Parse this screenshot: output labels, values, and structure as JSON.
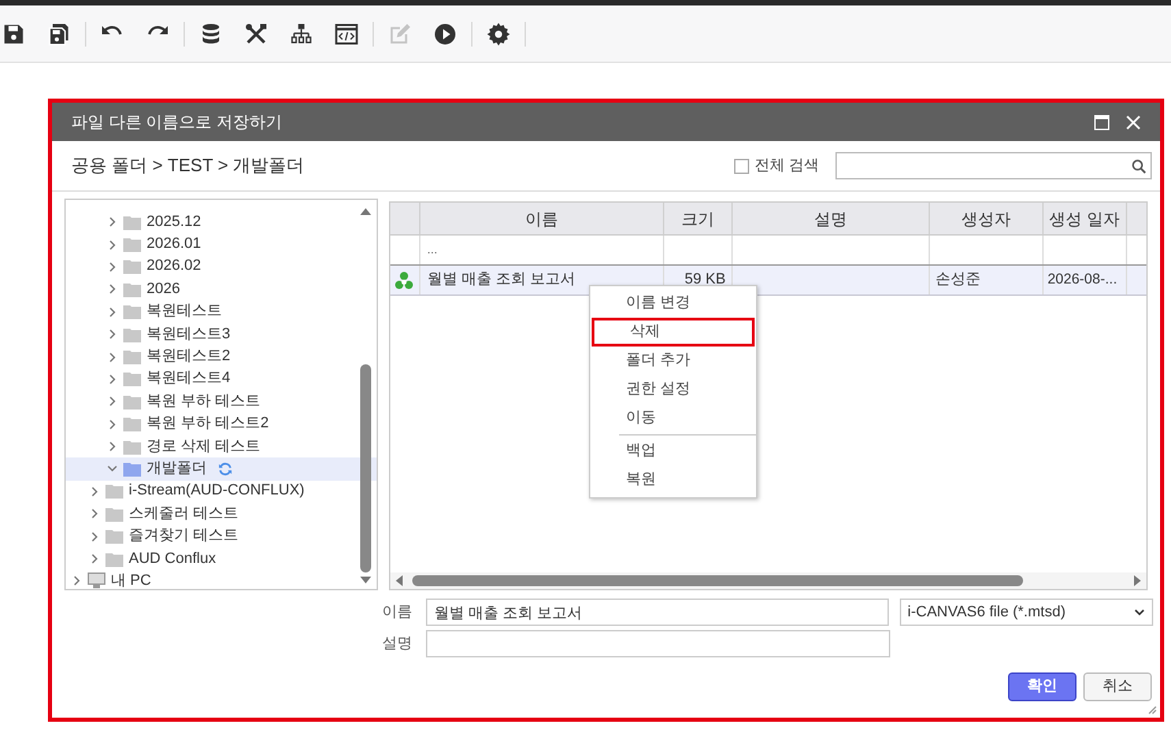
{
  "toolbar": [
    [
      {
        "kind": "save",
        "disabled": false
      },
      {
        "kind": "save-as",
        "disabled": false
      }
    ],
    [
      {
        "kind": "undo",
        "disabled": false
      },
      {
        "kind": "redo",
        "disabled": false
      }
    ],
    [
      {
        "kind": "database",
        "disabled": false
      },
      {
        "kind": "tools",
        "disabled": false
      },
      {
        "kind": "hierarchy",
        "disabled": false
      },
      {
        "kind": "code-window",
        "disabled": false
      }
    ],
    [
      {
        "kind": "edit",
        "disabled": true
      },
      {
        "kind": "play",
        "disabled": false
      }
    ],
    [
      {
        "kind": "settings",
        "disabled": false
      }
    ]
  ],
  "dialog": {
    "title": "파일 다른 이름으로 저장하기",
    "breadcrumb": "공용 폴더 > TEST > 개발폴더",
    "search_all": {
      "label": "전체 검색",
      "checked": false
    },
    "tree": [
      {
        "children": [
          {
            "children": [
              {
                "label": "2025.12",
                "kind": "folder",
                "expanded": false,
                "selected": false
              },
              {
                "label": "2026.01",
                "kind": "folder",
                "expanded": false,
                "selected": false
              },
              {
                "label": "2026.02",
                "kind": "folder",
                "expanded": false,
                "selected": false
              },
              {
                "label": "2026",
                "kind": "folder",
                "expanded": false,
                "selected": false
              },
              {
                "label": "복원테스트",
                "kind": "folder",
                "expanded": false,
                "selected": false
              },
              {
                "label": "복원테스트3",
                "kind": "folder",
                "expanded": false,
                "selected": false
              },
              {
                "label": "복원테스트2",
                "kind": "folder",
                "expanded": false,
                "selected": false
              },
              {
                "label": "복원테스트4",
                "kind": "folder",
                "expanded": false,
                "selected": false
              },
              {
                "label": "복원 부하 테스트",
                "kind": "folder",
                "expanded": false,
                "selected": false
              },
              {
                "label": "복원 부하 테스트2",
                "kind": "folder",
                "expanded": false,
                "selected": false
              },
              {
                "label": "경로 삭제 테스트",
                "kind": "folder",
                "expanded": false,
                "selected": false
              },
              {
                "label": "개발폴더",
                "kind": "folder",
                "expanded": true,
                "selected": true
              }
            ]
          },
          {
            "label": "i-Stream(AUD-CONFLUX)",
            "kind": "folder",
            "expanded": false,
            "selected": false
          },
          {
            "label": "스케줄러 테스트",
            "kind": "folder",
            "expanded": false,
            "selected": false
          },
          {
            "label": "즐겨찾기 테스트",
            "kind": "folder",
            "expanded": false,
            "selected": false
          },
          {
            "label": "AUD Conflux",
            "kind": "folder",
            "expanded": false,
            "selected": false
          }
        ]
      },
      {
        "label": "내 PC",
        "kind": "pc",
        "expanded": false,
        "selected": false
      }
    ],
    "table": {
      "columns": [
        "이름",
        "크기",
        "설명",
        "생성자",
        "생성 일자"
      ],
      "rows": [
        {
          "kind": "parent",
          "name": "...",
          "selected": false
        },
        {
          "kind": "file",
          "name": "월별 매출 조회 보고서",
          "size": "59 KB",
          "creator": "손성준",
          "date": "2026-08-...",
          "selected": true
        }
      ]
    },
    "context_menu": [
      {
        "kind": "item",
        "label": "이름 변경",
        "highlighted": false
      },
      {
        "kind": "item",
        "label": "삭제",
        "highlighted": true
      },
      {
        "kind": "item",
        "label": "폴더 추가",
        "highlighted": false
      },
      {
        "kind": "item",
        "label": "권한 설정",
        "highlighted": false
      },
      {
        "kind": "item",
        "label": "이동",
        "highlighted": false
      },
      {
        "kind": "separator"
      },
      {
        "kind": "item",
        "label": "백업",
        "highlighted": false
      },
      {
        "kind": "item",
        "label": "복원",
        "highlighted": false
      }
    ],
    "form": {
      "name_label": "이름",
      "name_value": "월별 매출 조회 보고서",
      "file_type": "i-CANVAS6 file (*.mtsd)",
      "desc_label": "설명"
    },
    "buttons": [
      {
        "kind": "primary",
        "label": "확인"
      },
      {
        "kind": "secondary",
        "label": "취소"
      }
    ]
  }
}
